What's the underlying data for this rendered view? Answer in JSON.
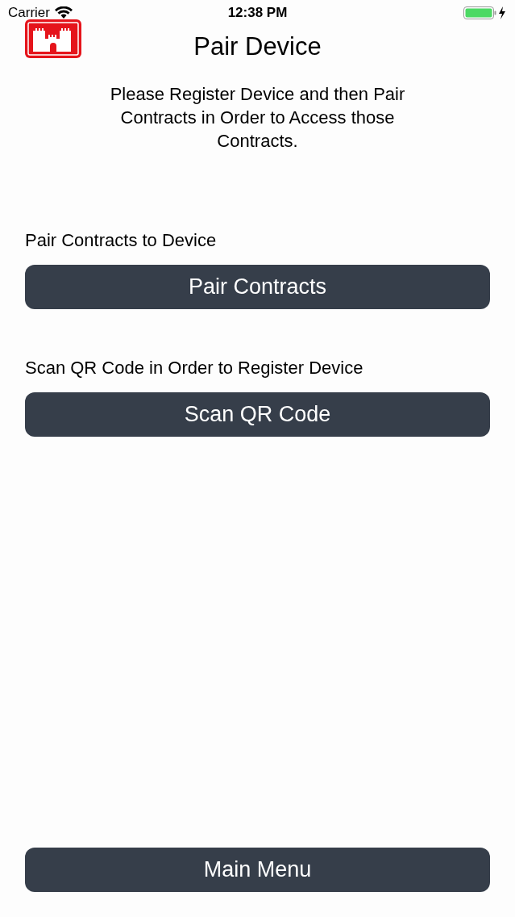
{
  "status_bar": {
    "carrier": "Carrier",
    "time": "12:38 PM"
  },
  "header": {
    "title": "Pair Device"
  },
  "instructions": "Please Register Device and then Pair Contracts in Order to Access those Contracts.",
  "sections": [
    {
      "label": "Pair Contracts to Device",
      "button": "Pair Contracts"
    },
    {
      "label": "Scan QR Code in Order to Register Device",
      "button": "Scan QR Code"
    }
  ],
  "footer_button": "Main Menu"
}
